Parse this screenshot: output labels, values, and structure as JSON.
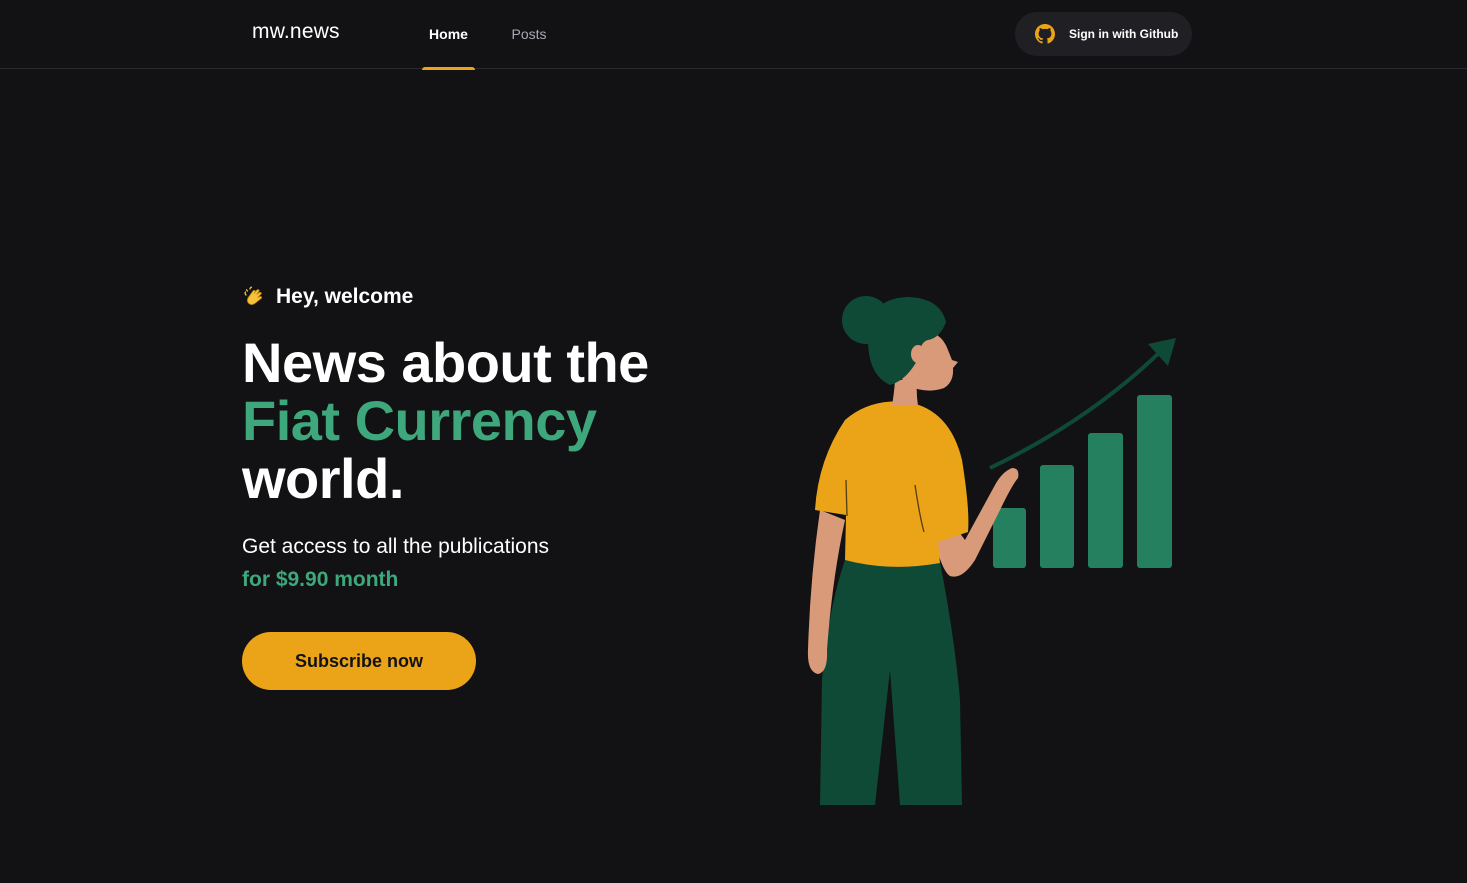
{
  "header": {
    "logo": "mw.news",
    "nav": [
      {
        "label": "Home",
        "active": true
      },
      {
        "label": "Posts",
        "active": false
      }
    ],
    "signin_label": "Sign in with Github",
    "signin_icon": "github-icon"
  },
  "hero": {
    "greeting_icon": "clapping-hands-icon",
    "greeting": "Hey, welcome",
    "headline_line1": "News about the",
    "headline_accent": "Fiat Currency",
    "headline_line3": "world.",
    "subtitle": "Get access to all the publications",
    "price": "for $9.90 month",
    "cta_label": "Subscribe now"
  },
  "illustration": {
    "name": "woman-presenting-growth-chart",
    "colors": {
      "shirt": "#eba417",
      "pants": "#0f4a36",
      "hair": "#0f4a36",
      "skin": "#d99a7a",
      "bars": "#25805f",
      "arrow": "#0f4a36"
    }
  },
  "colors": {
    "background": "#121214",
    "accent_green": "#3fa77c",
    "accent_yellow": "#eba417",
    "button_dark": "#202024"
  }
}
